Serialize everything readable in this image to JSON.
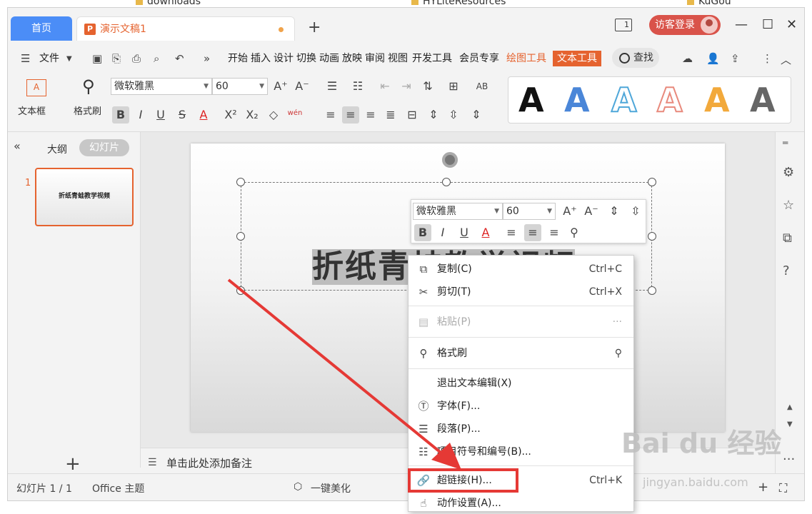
{
  "desktop": {
    "folders": [
      "downloads",
      "HYLiteResources",
      "KuGou"
    ]
  },
  "tabs": {
    "home": "首页",
    "doc_icon": "P",
    "doc_title": "演示文稿1",
    "new_tab": "+"
  },
  "window": {
    "layout_badge": "1",
    "login": "访客登录"
  },
  "menu": {
    "file": "文件",
    "tabs": [
      "开始",
      "插入",
      "设计",
      "切换",
      "动画",
      "放映",
      "审阅",
      "视图",
      "开发工具",
      "会员专享"
    ],
    "draw_tools": "绘图工具",
    "text_tools": "文本工具",
    "search": "查找"
  },
  "ribbon": {
    "textbox": "文本框",
    "format_painter": "格式刷",
    "font": "微软雅黑",
    "size": "60",
    "pinyin": "wén"
  },
  "left_pane": {
    "outline": "大纲",
    "slides": "幻灯片",
    "slide_number": "1",
    "thumb_title": "折纸青蛙教学视频"
  },
  "slide": {
    "title": "折纸青蛙教学视频"
  },
  "mini_toolbar": {
    "font": "微软雅黑",
    "size": "60"
  },
  "notes": {
    "placeholder": "单击此处添加备注"
  },
  "status": {
    "slide_count": "幻灯片 1 / 1",
    "theme": "Office 主题",
    "beautify": "一键美化"
  },
  "context_menu": {
    "copy": "复制(C)",
    "copy_shortcut": "Ctrl+C",
    "cut": "剪切(T)",
    "cut_shortcut": "Ctrl+X",
    "paste": "粘贴(P)",
    "format_painter": "格式刷",
    "exit_edit": "退出文本编辑(X)",
    "font": "字体(F)...",
    "paragraph": "段落(P)...",
    "bullets": "项目符号和编号(B)...",
    "hyperlink": "超链接(H)...",
    "hyperlink_shortcut": "Ctrl+K",
    "action": "动作设置(A)..."
  },
  "watermark": {
    "brand": "Bai du 经验",
    "url": "jingyan.baidu.com"
  },
  "colors": {
    "accent": "#e5632f",
    "tab_blue": "#4b8df7",
    "login": "#d9534a",
    "highlight": "#e53935"
  }
}
